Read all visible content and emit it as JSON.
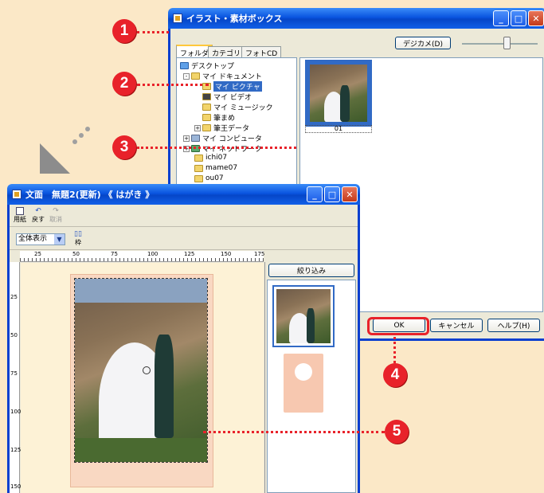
{
  "back_window": {
    "title": "イラスト・素材ボックス",
    "tabs": [
      "フォルダ",
      "カテゴリ",
      "フォトCD"
    ],
    "camera_button": "デジカメ(D)",
    "tree": [
      "デスクトップ",
      "マイ ドキュメント",
      "マイ ピクチャ",
      "マイ ビデオ",
      "マイ ミュージック",
      "筆まめ",
      "筆王データ",
      "マイ コンピュータ",
      "マイ ネットワーク",
      "ichi07",
      "mame07",
      "ou07"
    ],
    "thumb_label": "01",
    "ok_button": "OK",
    "cancel_button": "キャンセル",
    "help_button": "ヘルプ(H)"
  },
  "front_window": {
    "title": "文面　無題2(更新) 《 はがき 》",
    "toolbar": {
      "paper": "用紙",
      "undo": "戻す",
      "cancel": "取消"
    },
    "view_select": "全体表示",
    "frame_label": "枠",
    "ruler_top": [
      "25",
      "50",
      "75",
      "100",
      "125",
      "150",
      "175"
    ],
    "ruler_left": [
      "25",
      "50",
      "75",
      "100",
      "125",
      "150"
    ],
    "filter_button": "絞り込み"
  },
  "badges": [
    "1",
    "2",
    "3",
    "4",
    "5"
  ],
  "colors": {
    "accent": "#e8222a",
    "background": "#fbe8c7",
    "titlebar": "#0a55e0"
  }
}
